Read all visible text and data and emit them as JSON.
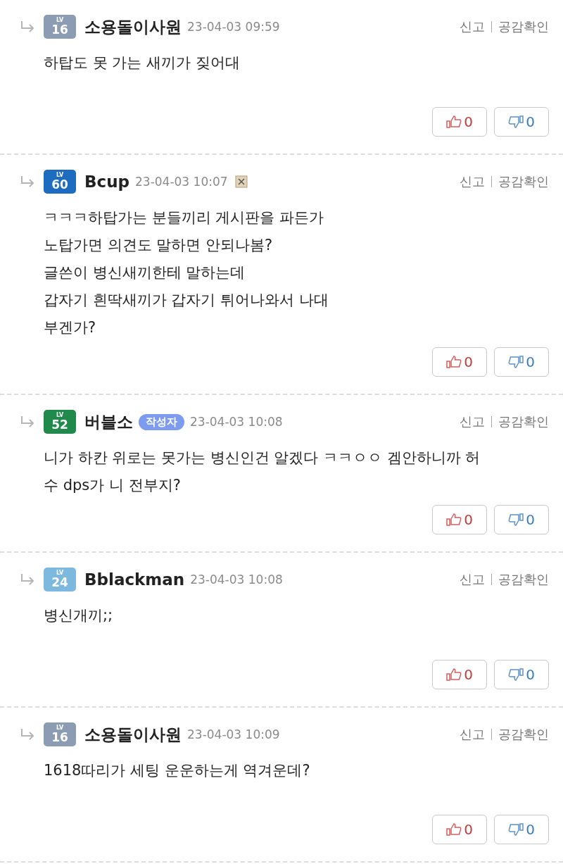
{
  "comments": [
    {
      "level_label": "LV",
      "level": "16",
      "color": "#8c9db3",
      "name": "소용돌이사원",
      "date": "23-04-03 09:59",
      "broken_image": false,
      "actions": [
        "신고",
        "공감확인"
      ],
      "lines": [
        "하탑도 못 가는 새끼가 짖어대"
      ],
      "likes": "0",
      "dislikes": "0"
    },
    {
      "level_label": "LV",
      "level": "60",
      "color": "#1e6cc0",
      "name": "Bcup",
      "date": "23-04-03 10:07",
      "broken_image": true,
      "actions": [
        "신고",
        "공감확인"
      ],
      "lines": [
        "ㅋㅋㅋ하탑가는 분들끼리 게시판을 파든가",
        "노탑가면 의견도 말하면 안되나봄?",
        "글쓴이 병신새끼한테 말하는데",
        "갑자기 흰딱새끼가 갑자기 튀어나와서 나대",
        "부겐가?"
      ],
      "likes": "0",
      "dislikes": "0"
    },
    {
      "level_label": "LV",
      "level": "52",
      "color": "#1f8a4c",
      "name": "버블소",
      "author_tag": "작성자",
      "date": "23-04-03 10:08",
      "broken_image": false,
      "actions": [
        "신고",
        "공감확인"
      ],
      "lines": [
        "니가 하칸 위로는 못가는 병신인건 알겠다 ㅋㅋㅇㅇ 겜안하니까 허",
        "수 dps가 니 전부지?"
      ],
      "likes": "0",
      "dislikes": "0"
    },
    {
      "level_label": "LV",
      "level": "24",
      "color": "#7db8de",
      "name": "Bblackman",
      "date": "23-04-03 10:08",
      "broken_image": false,
      "actions": [
        "신고",
        "공감확인"
      ],
      "lines": [
        "병신개끼;;"
      ],
      "likes": "0",
      "dislikes": "0"
    },
    {
      "level_label": "LV",
      "level": "16",
      "color": "#8c9db3",
      "name": "소용돌이사원",
      "date": "23-04-03 10:09",
      "broken_image": false,
      "actions": [
        "신고",
        "공감확인"
      ],
      "lines": [
        "1618따리가 세팅 운운하는게 역겨운데?"
      ],
      "likes": "0",
      "dislikes": "0"
    }
  ]
}
